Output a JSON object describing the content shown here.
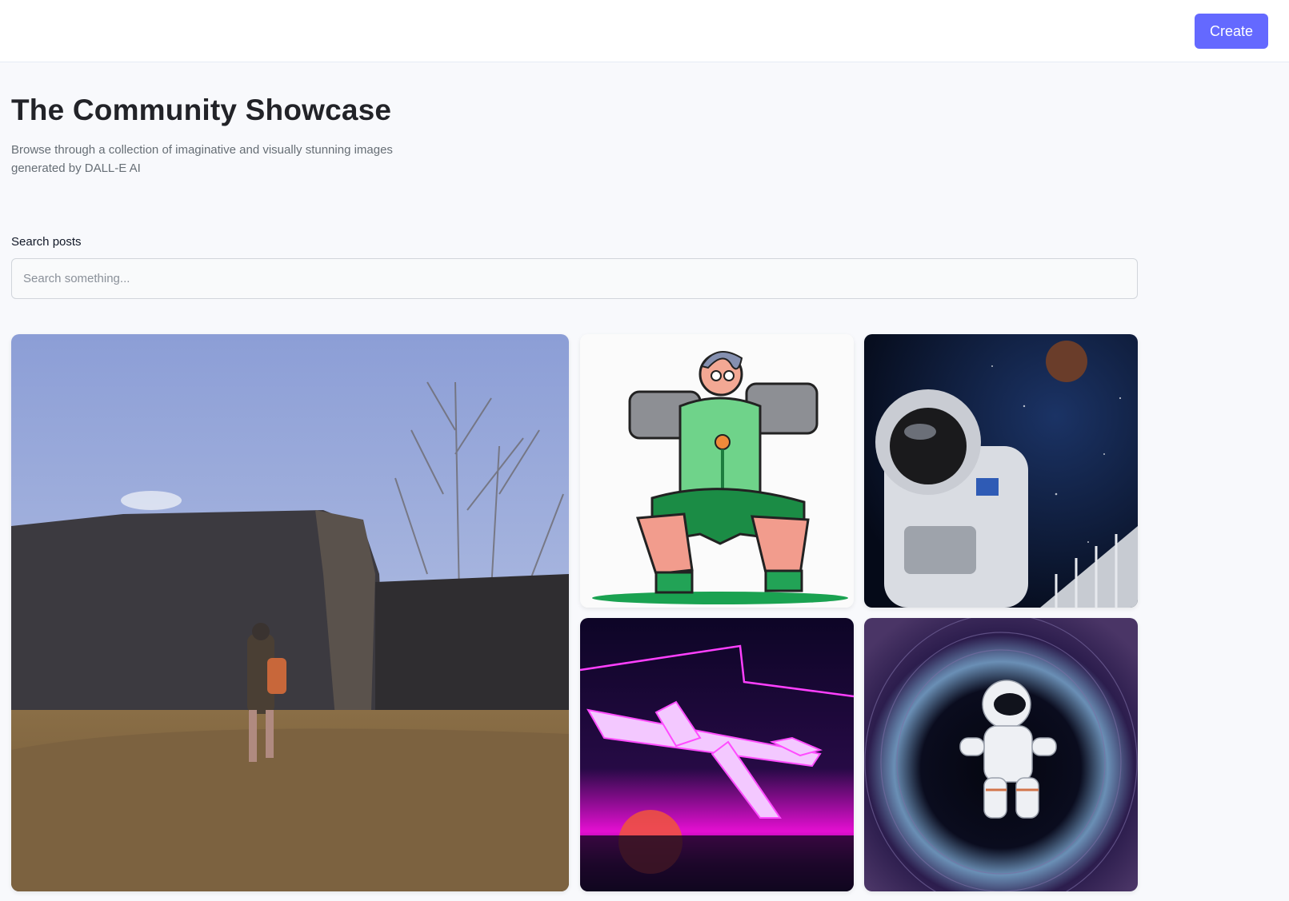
{
  "header": {
    "create_label": "Create",
    "accent_color": "#6469ff"
  },
  "main": {
    "title": "The Community Showcase",
    "subtitle": "Browse through a collection of imaginative and visually stunning images generated by DALL-E AI"
  },
  "search": {
    "label": "Search posts",
    "placeholder": "Search something...",
    "value": ""
  },
  "gallery": {
    "cards": [
      {
        "subject": "person with backpack by ruined wall in dry field"
      },
      {
        "subject": "cartoon weightlifter holding dumbbells"
      },
      {
        "subject": "astronaut in space near a planet"
      },
      {
        "subject": "neon synthwave jet fighter over sunset"
      },
      {
        "subject": "astronaut floating in a swirling portal"
      }
    ]
  }
}
